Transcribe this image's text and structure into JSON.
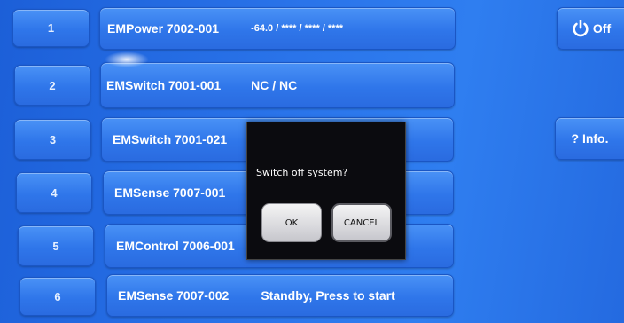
{
  "rows": [
    {
      "number": "1",
      "name": "EMPower 7002-001",
      "value": "-64.0 / **** / **** / ****"
    },
    {
      "number": "2",
      "name": "EMSwitch 7001-001",
      "value": "NC / NC"
    },
    {
      "number": "3",
      "name": "EMSwitch 7001-021",
      "value": ""
    },
    {
      "number": "4",
      "name": "EMSense 7007-001",
      "value": ""
    },
    {
      "number": "5",
      "name": "EMControl 7006-001",
      "value": ""
    },
    {
      "number": "6",
      "name": "EMSense 7007-002",
      "value": "Standby, Press to start"
    }
  ],
  "side": {
    "off_label": "Off",
    "info_label": "? Info."
  },
  "dialog": {
    "message": "Switch off system?",
    "ok_label": "OK",
    "cancel_label": "CANCEL"
  },
  "colors": {
    "background": "#2a74ea",
    "button": "#2f76ea",
    "dialog": "#0b0b0f"
  },
  "icons": {
    "power": "power-icon"
  }
}
